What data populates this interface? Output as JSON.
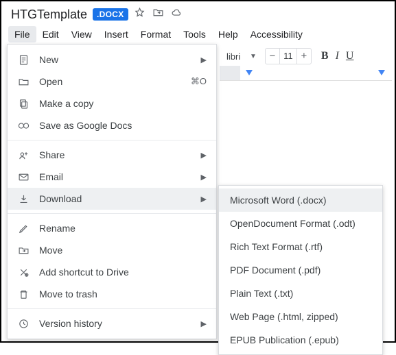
{
  "doc": {
    "title": "HTGTemplate",
    "badge": ".DOCX"
  },
  "menubar": [
    "File",
    "Edit",
    "View",
    "Insert",
    "Format",
    "Tools",
    "Help",
    "Accessibility"
  ],
  "toolbar": {
    "font": "libri",
    "size": "11"
  },
  "fileMenu": {
    "items": [
      {
        "label": "New",
        "arrow": true
      },
      {
        "label": "Open",
        "shortcut": "⌘O"
      },
      {
        "label": "Make a copy"
      },
      {
        "label": "Save as Google Docs"
      }
    ],
    "group2": [
      {
        "label": "Share",
        "arrow": true
      },
      {
        "label": "Email",
        "arrow": true
      },
      {
        "label": "Download",
        "arrow": true,
        "highlight": true
      }
    ],
    "group3": [
      {
        "label": "Rename"
      },
      {
        "label": "Move"
      },
      {
        "label": "Add shortcut to Drive"
      },
      {
        "label": "Move to trash"
      }
    ],
    "group4": [
      {
        "label": "Version history",
        "arrow": true
      }
    ]
  },
  "downloadSub": [
    {
      "label": "Microsoft Word (.docx)",
      "highlight": true
    },
    {
      "label": "OpenDocument Format (.odt)"
    },
    {
      "label": "Rich Text Format (.rtf)"
    },
    {
      "label": "PDF Document (.pdf)"
    },
    {
      "label": "Plain Text (.txt)"
    },
    {
      "label": "Web Page (.html, zipped)"
    },
    {
      "label": "EPUB Publication (.epub)"
    }
  ]
}
